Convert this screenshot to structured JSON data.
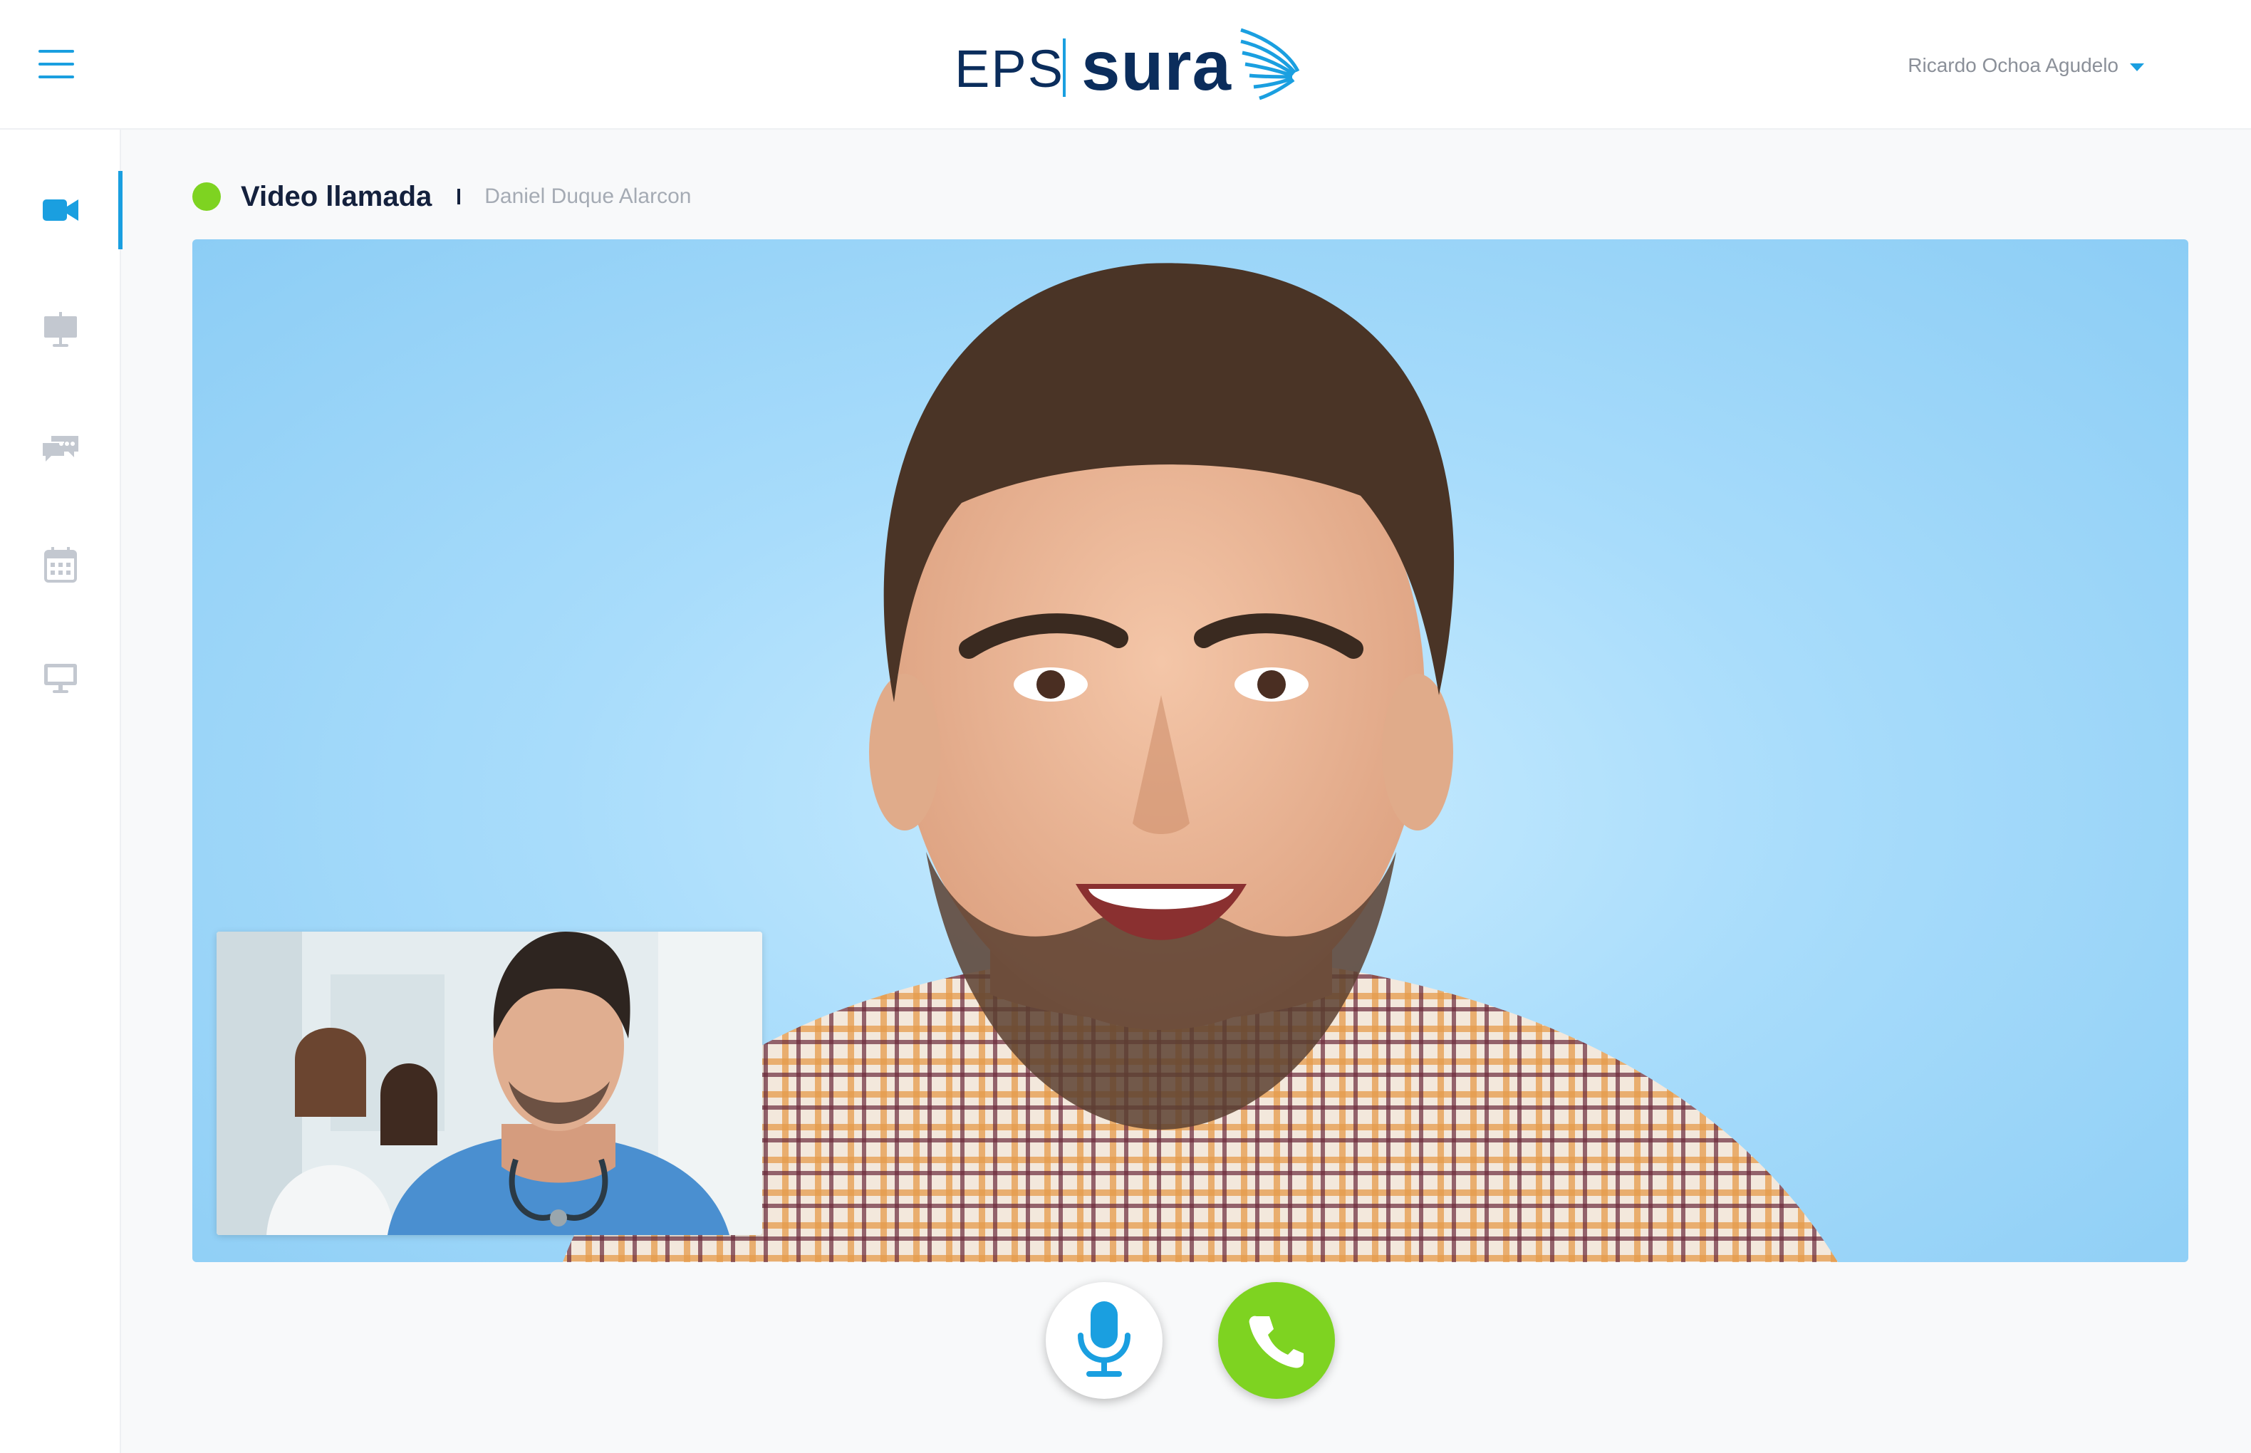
{
  "header": {
    "logo_eps": "EPS",
    "logo_brand": "sura",
    "user_name": "Ricardo Ochoa Agudelo"
  },
  "sidebar": {
    "items": [
      {
        "icon": "video-camera-icon",
        "active": true
      },
      {
        "icon": "presentation-board-icon",
        "active": false
      },
      {
        "icon": "chat-bubbles-icon",
        "active": false
      },
      {
        "icon": "calendar-icon",
        "active": false
      },
      {
        "icon": "monitor-icon",
        "active": false
      }
    ]
  },
  "call": {
    "title": "Video llamada",
    "status": "online",
    "contact_name": "Daniel Duque Alarcon"
  },
  "colors": {
    "accent": "#1a9fe0",
    "brand_navy": "#0b2d5c",
    "status_green": "#7ed321",
    "video_background": "#a8dcfb"
  },
  "controls": {
    "mic_icon": "microphone-icon",
    "call_icon": "phone-icon"
  }
}
